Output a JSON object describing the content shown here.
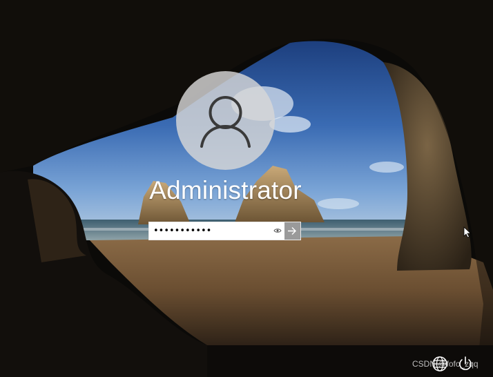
{
  "user": {
    "name": "Administrator"
  },
  "password": {
    "value": "•••••••••••"
  },
  "icons": {
    "avatar": "user-silhouette-icon",
    "reveal": "eye-icon",
    "submit": "arrow-right-icon",
    "ease_of_access": "ease-of-access-icon",
    "power": "power-icon",
    "cursor": "mouse-pointer-icon"
  },
  "watermark": {
    "text": "CSDN @fofo_zqq"
  },
  "colors": {
    "submit_bg": "#9a9a9a",
    "avatar_bg": "#d7d7d7",
    "field_bg": "#ffffff"
  }
}
